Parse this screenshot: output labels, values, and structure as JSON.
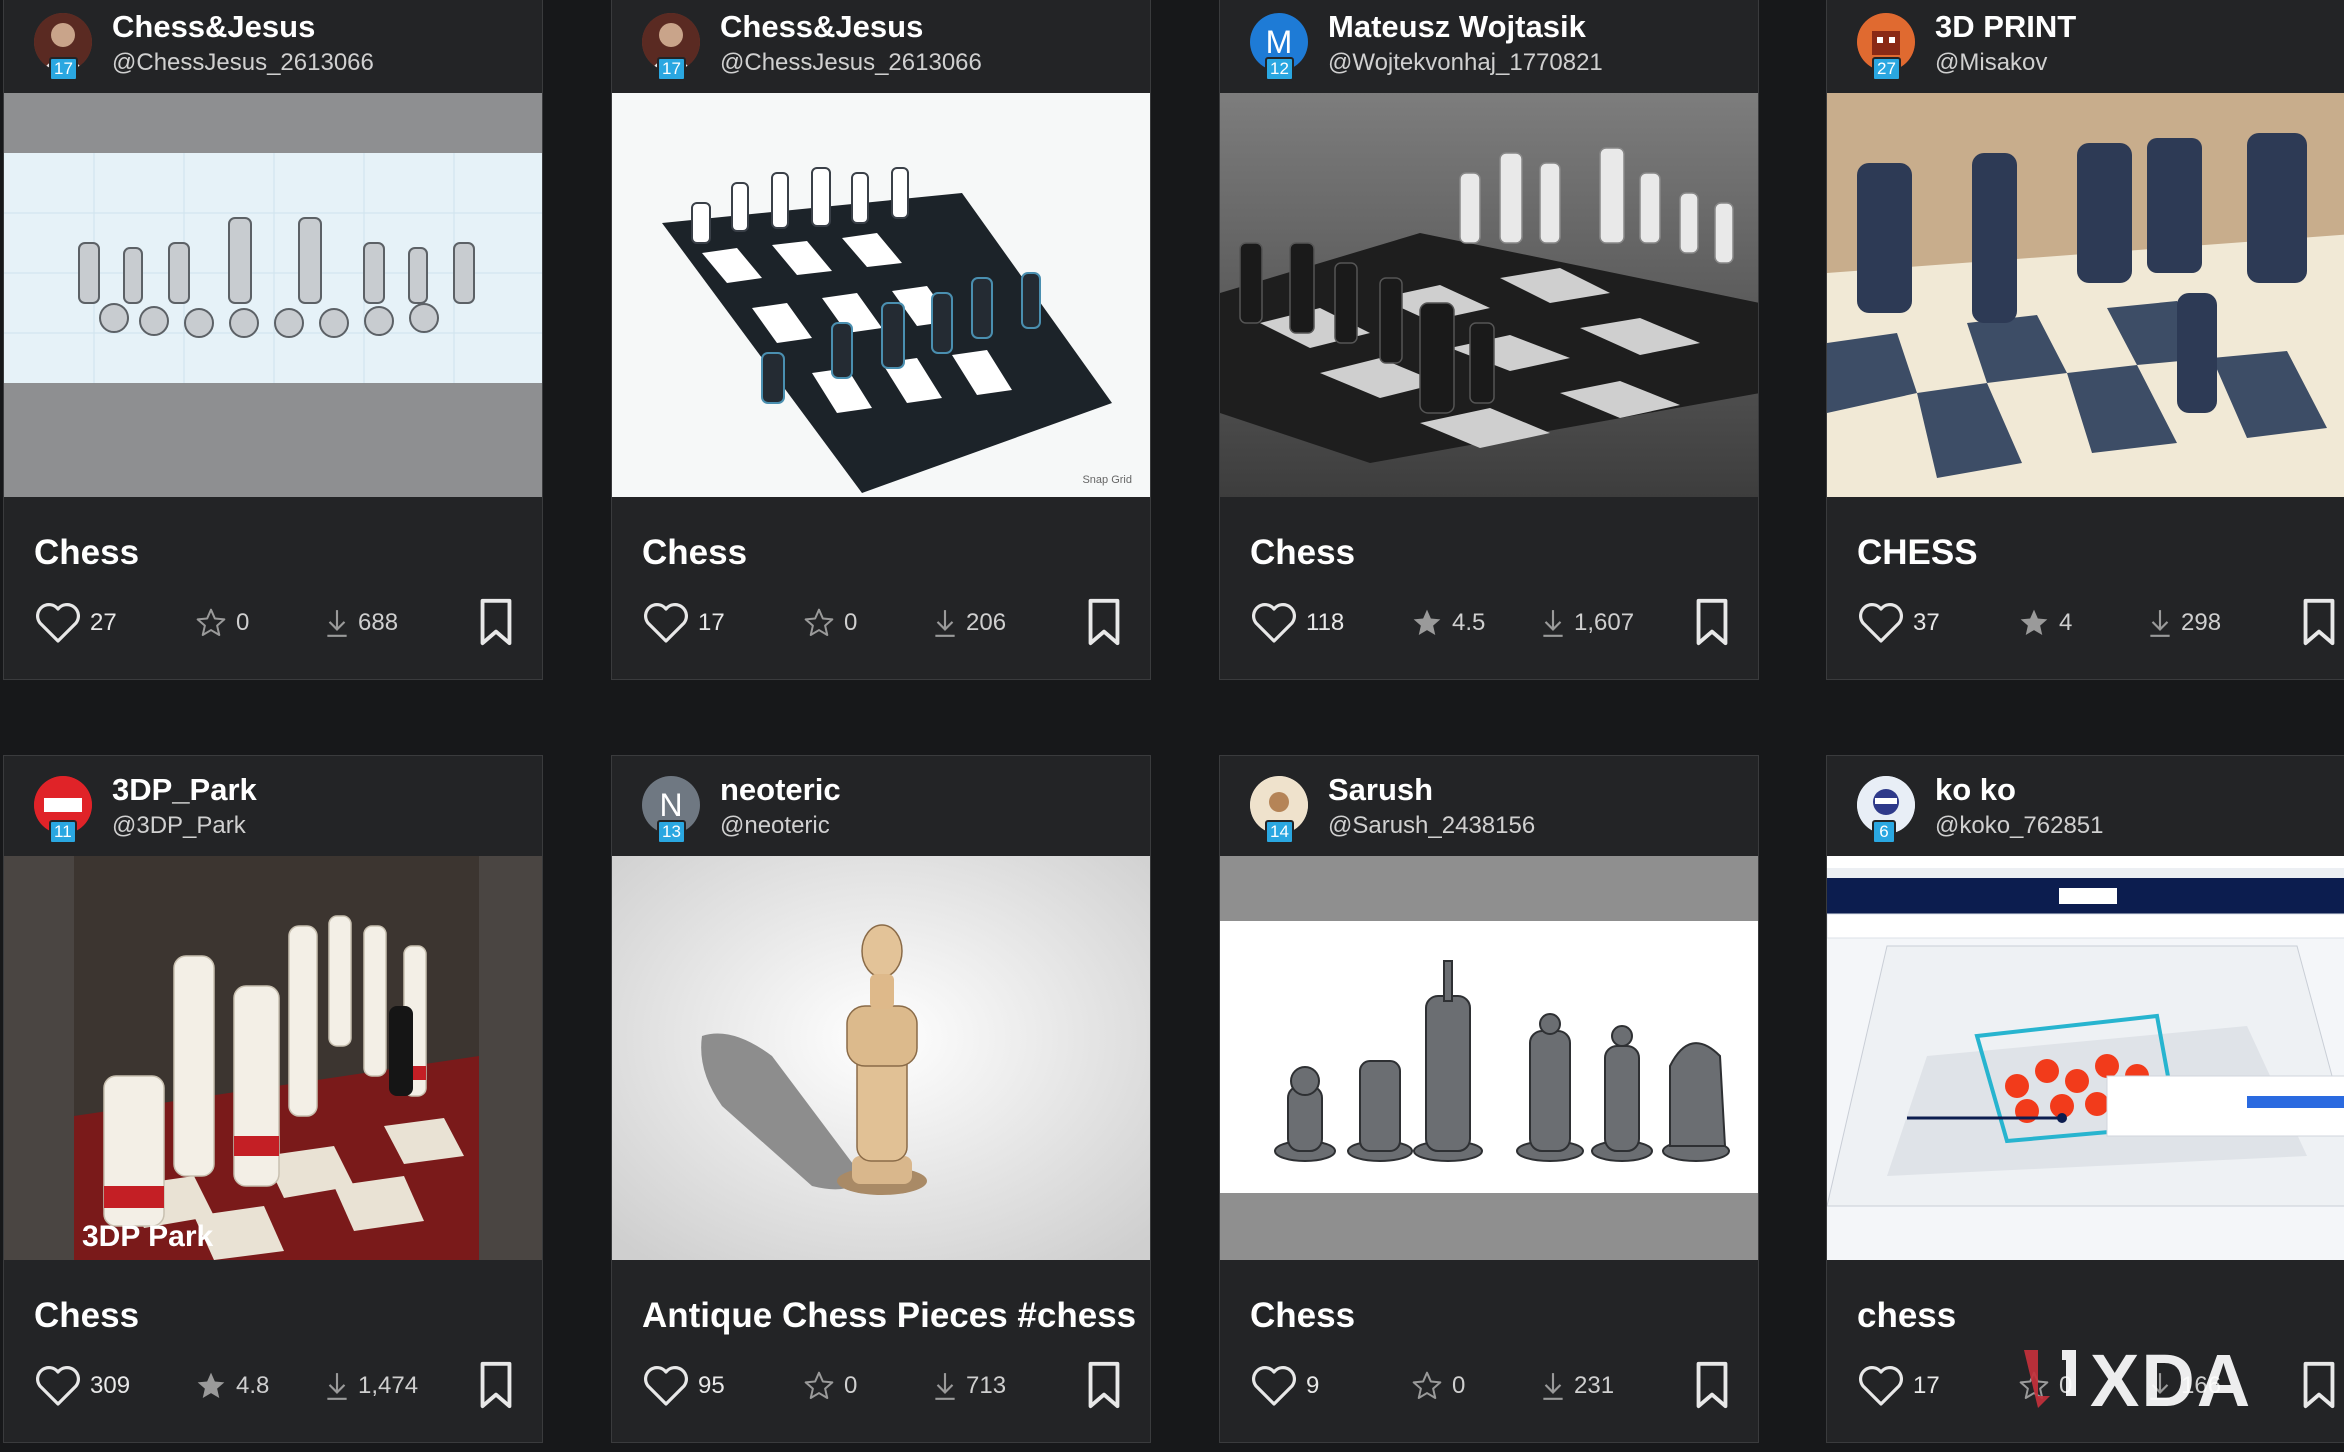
{
  "cards": [
    {
      "name": "Chess&Jesus",
      "handle": "@ChessJesus_2613066",
      "level": "17",
      "title": "Chess",
      "likes": "27",
      "rating": "0",
      "downloads": "688"
    },
    {
      "name": "Chess&Jesus",
      "handle": "@ChessJesus_2613066",
      "level": "17",
      "title": "Chess",
      "likes": "17",
      "rating": "0",
      "downloads": "206",
      "caption": "Snap Grid"
    },
    {
      "name": "Mateusz Wojtasik",
      "handle": "@Wojtekvonhaj_1770821",
      "level": "12",
      "avatar_letter": "M",
      "title": "Chess",
      "likes": "118",
      "rating": "4.5",
      "downloads": "1,607"
    },
    {
      "name": "3D PRINT",
      "handle": "@Misakov",
      "level": "27",
      "title": "CHESS",
      "likes": "37",
      "rating": "4",
      "downloads": "298"
    },
    {
      "name": "3DP_Park",
      "handle": "@3DP_Park",
      "level": "11",
      "title": "Chess",
      "likes": "309",
      "rating": "4.8",
      "downloads": "1,474",
      "caption": "3DP Park"
    },
    {
      "name": "neoteric",
      "handle": "@neoteric",
      "level": "13",
      "avatar_letter": "N",
      "title": "Antique Chess Pieces #chess",
      "likes": "95",
      "rating": "0",
      "downloads": "713"
    },
    {
      "name": "Sarush",
      "handle": "@Sarush_2438156",
      "level": "14",
      "title": "Chess",
      "likes": "9",
      "rating": "0",
      "downloads": "231"
    },
    {
      "name": "ko ko",
      "handle": "@koko_762851",
      "level": "6",
      "title": "chess",
      "likes": "17",
      "rating": "0",
      "downloads": "166"
    }
  ],
  "watermark": "XDA",
  "colors": {
    "background": "#17181a",
    "card": "#232426",
    "level_badge": "#2aa7e1"
  }
}
